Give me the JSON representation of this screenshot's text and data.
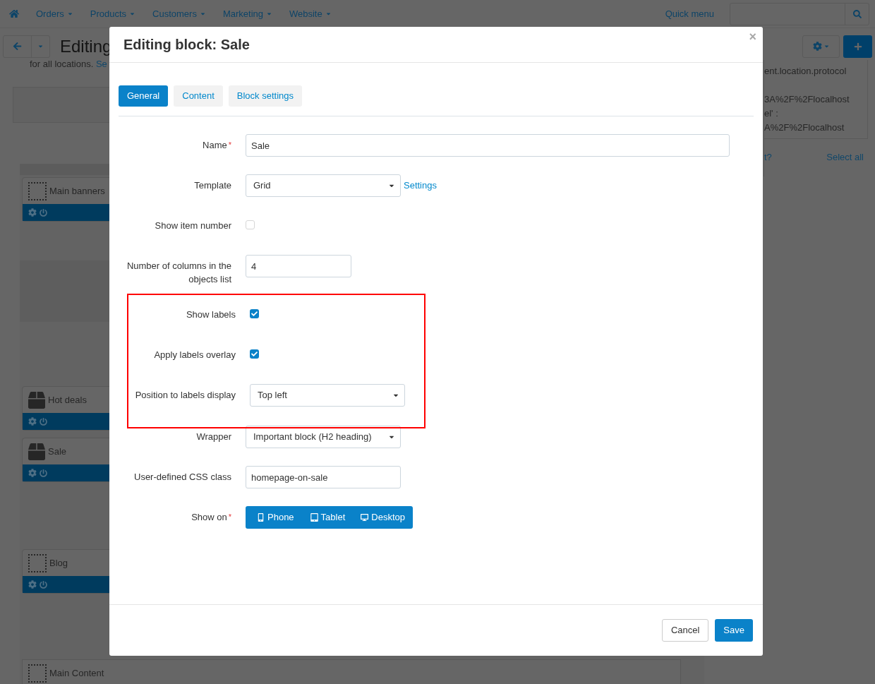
{
  "nav": {
    "items": [
      "Orders",
      "Products",
      "Customers",
      "Marketing",
      "Website"
    ],
    "quick_menu": "Quick menu"
  },
  "page": {
    "title": "Editing",
    "note": "for all locations.",
    "note_link": "Se"
  },
  "layout_blocks": [
    {
      "name": "Main banners",
      "kind": "container"
    },
    {
      "name": "Hot deals",
      "kind": "box"
    },
    {
      "name": "Sale",
      "kind": "box"
    },
    {
      "name": "Blog",
      "kind": "container"
    }
  ],
  "main_content": "Main Content",
  "side_panel": {
    "code_lines": [
      "ent.location.protocol",
      "3A%2F%2Flocalhost",
      "el' :",
      "A%2F%2Flocalhost"
    ],
    "link": "t?",
    "select_all": "Select all"
  },
  "modal": {
    "title": "Editing block: Sale",
    "close": "×",
    "tabs": [
      {
        "label": "General",
        "selected": true
      },
      {
        "label": "Content",
        "selected": false
      },
      {
        "label": "Block settings",
        "selected": false
      }
    ],
    "sections": [
      {
        "highlighted": false,
        "fields": [
          {
            "kind": "widetext",
            "label": "Name",
            "required_mark": "*",
            "value": "Sale"
          },
          {
            "kind": "select",
            "label": "Template",
            "value": "Grid",
            "link": "Settings"
          },
          {
            "kind": "checkbox",
            "label": "Show item number",
            "checked": false
          },
          {
            "kind": "number",
            "label": "Number of columns in the objects list",
            "value": "4"
          }
        ]
      },
      {
        "highlighted": true,
        "fields": [
          {
            "kind": "checkbox",
            "label": "Show labels",
            "checked": true
          },
          {
            "kind": "checkbox",
            "label": "Apply labels overlay",
            "checked": true
          },
          {
            "kind": "select",
            "label": "Position to labels display",
            "value": "Top left"
          }
        ]
      },
      {
        "highlighted": false,
        "fields": [
          {
            "kind": "select",
            "label": "Wrapper",
            "value": "Important block (H2 heading)"
          },
          {
            "kind": "text",
            "label": "User-defined CSS class",
            "value": "homepage-on-sale"
          },
          {
            "kind": "toggles",
            "label": "Show on",
            "required_mark": "*",
            "options": [
              {
                "label": "Phone",
                "kind": "phone",
                "selected": true
              },
              {
                "label": "Tablet",
                "kind": "tablet",
                "selected": true
              },
              {
                "label": "Desktop",
                "kind": "desktop",
                "selected": true
              }
            ]
          }
        ]
      }
    ],
    "buttons": [
      {
        "label": "Cancel",
        "kind": "secondary"
      },
      {
        "label": "Save",
        "kind": "primary"
      }
    ]
  }
}
